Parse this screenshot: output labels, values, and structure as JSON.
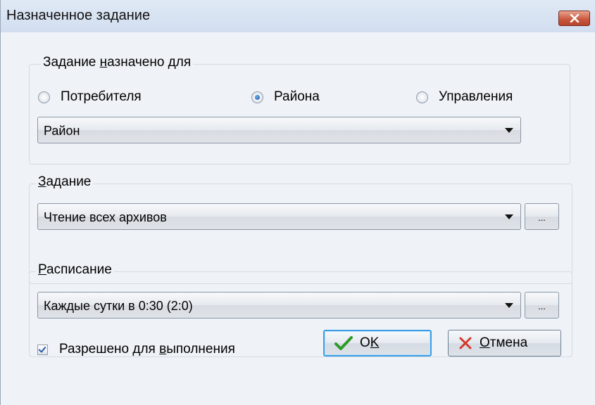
{
  "window": {
    "title": "Назначенное задание"
  },
  "assigned_for": {
    "label_pre": "Задание ",
    "label_accel": "н",
    "label_post": "азначено для",
    "options": [
      {
        "label": "Потребителя",
        "checked": false
      },
      {
        "label": "Района",
        "checked": true
      },
      {
        "label": "Управления",
        "checked": false
      }
    ],
    "select_value": "Район"
  },
  "task": {
    "label_accel": "З",
    "label_post": "адание",
    "select_value": "Чтение всех архивов",
    "browse_label": "..."
  },
  "schedule": {
    "label_accel": "Р",
    "label_post": "асписание",
    "select_value": "Каждые  сутки в 0:30 (2:0)",
    "browse_label": "..."
  },
  "enabled": {
    "label_pre": "Разрешено для ",
    "label_accel": "в",
    "label_post": "ыполнения",
    "checked": true
  },
  "buttons": {
    "ok_pre": "О",
    "ok_accel": "K",
    "cancel_accel": "О",
    "cancel_post": "тмена"
  },
  "icons": {
    "close": "close-icon",
    "ok": "checkmark-icon",
    "cancel": "cross-icon"
  },
  "colors": {
    "ok_check": "#2e9a2a",
    "cancel_cross": "#d23a2a",
    "close_button": "#c8553c"
  }
}
